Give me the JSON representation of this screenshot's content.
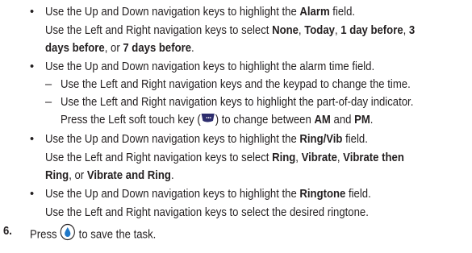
{
  "bullets": {
    "alarm": {
      "l1a": "Use the Up and Down navigation keys to highlight the ",
      "l1b": "Alarm",
      "l1c": " field.",
      "l2a": "Use the Left and Right navigation keys to select ",
      "o1": "None",
      "s1": ", ",
      "o2": "Today",
      "s2": ", ",
      "o3": "1 day before",
      "s3": ", ",
      "o4a": "3",
      "o4b": "days before",
      "s4": ", or ",
      "o5": "7 days before",
      "s5": "."
    },
    "alarm_time": {
      "l1": "Use the Up and Down navigation keys to highlight the alarm time field.",
      "d1": "Use the Left and Right navigation keys and the keypad to change the time.",
      "d2": "Use the Left and Right navigation keys to highlight the part-of-day indicator.",
      "d3a": "Press the Left soft touch key (",
      "d3b": ") to change between ",
      "am": "AM",
      "and": " and ",
      "pm": "PM",
      "end": "."
    },
    "ring": {
      "l1a": "Use the Up and Down navigation keys to highlight the ",
      "l1b": "Ring/Vib",
      "l1c": " field.",
      "l2a": "Use the Left and Right navigation keys to select ",
      "o1": "Ring",
      "s1": ", ",
      "o2": "Vibrate",
      "s2": ", ",
      "o3a": "Vibrate then",
      "o3b": "Ring",
      "s3": ", or ",
      "o4": "Vibrate and Ring",
      "s4": "."
    },
    "ringtone": {
      "l1a": "Use the Up and Down navigation keys to highlight the ",
      "l1b": "Ringtone",
      "l1c": " field.",
      "l2": "Use the Left and Right navigation keys to select the desired ringtone."
    }
  },
  "step6": {
    "number": "6.",
    "a": "Press ",
    "b": " to save the task."
  },
  "symbols": {
    "bullet": "•",
    "dash": "–"
  },
  "icons": {
    "soft_key": "left-soft-touch-key-icon",
    "ok": "ok-key-icon",
    "soft_key_color": "#2d2d6e",
    "ok_color": "#1f78c8"
  }
}
